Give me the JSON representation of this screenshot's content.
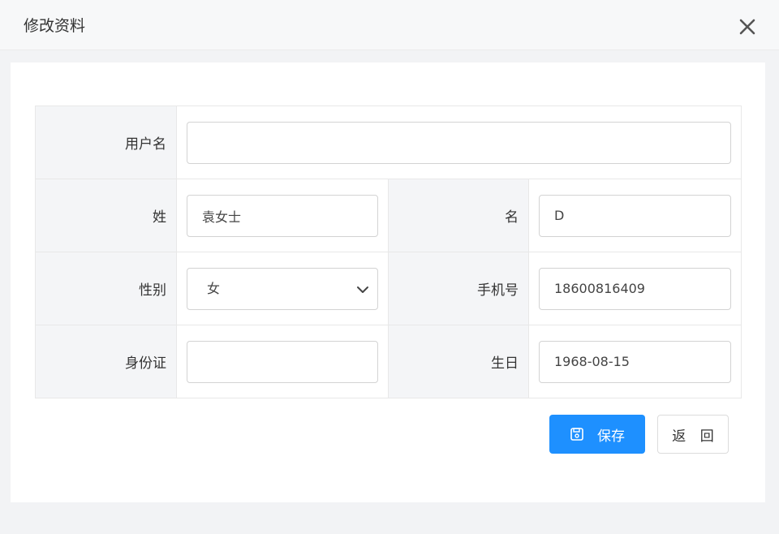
{
  "dialog": {
    "title": "修改资料"
  },
  "form": {
    "username": {
      "label": "用户名",
      "value": ""
    },
    "last_name": {
      "label": "姓",
      "value": "袁女士"
    },
    "first_name": {
      "label": "名",
      "value": "D"
    },
    "gender": {
      "label": "性别",
      "value": "女"
    },
    "phone": {
      "label": "手机号",
      "value": "18600816409"
    },
    "id_card": {
      "label": "身份证",
      "value": ""
    },
    "birthday": {
      "label": "生日",
      "value": "1968-08-15"
    }
  },
  "actions": {
    "save_label": "保存",
    "back_label": "返 回"
  },
  "icons": {
    "close": "close-icon",
    "save": "floppy-disk-icon",
    "dropdown": "chevron-down-icon"
  },
  "colors": {
    "primary": "#1e90ff",
    "label_bg": "#f4f5f7",
    "border": "#e8e8e8"
  }
}
